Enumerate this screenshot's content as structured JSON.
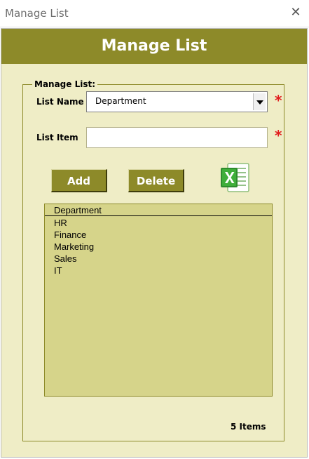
{
  "window": {
    "title": "Manage List"
  },
  "header": {
    "title": "Manage List"
  },
  "form": {
    "group_label": "Manage List:",
    "list_name_label": "List Name",
    "list_name_value": "Department",
    "list_item_label": "List Item",
    "list_item_value": "",
    "required_marker": "*"
  },
  "buttons": {
    "add": "Add",
    "delete": "Delete"
  },
  "icons": {
    "close": "close-icon",
    "excel": "excel-icon",
    "dropdown": "chevron-down-icon"
  },
  "list": {
    "header": "Department",
    "items": [
      "HR",
      "Finance",
      "Marketing",
      "Sales",
      "IT"
    ]
  },
  "status": {
    "count_text": "5 Items"
  },
  "colors": {
    "header_bg": "#8d8a29",
    "panel_bg": "#efedc6",
    "list_bg": "#d6d48a",
    "required": "#e11d1d"
  }
}
